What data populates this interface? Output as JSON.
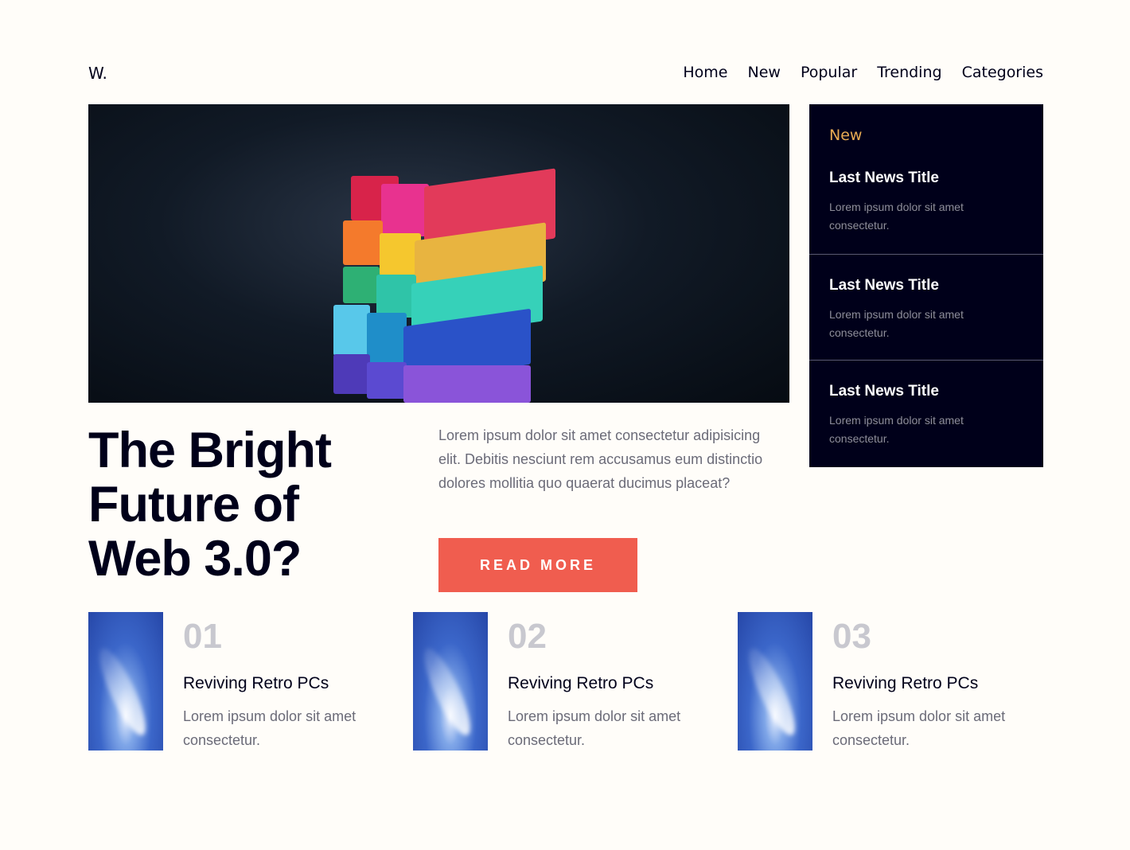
{
  "header": {
    "logo": "W.",
    "nav": [
      "Home",
      "New",
      "Popular",
      "Trending",
      "Categories"
    ]
  },
  "hero": {
    "image_alt": "colorful chalk pastels stacked",
    "title": "The Bright Future of Web 3.0?",
    "description": "Lorem ipsum dolor sit amet consectetur adipisicing elit. Debitis nesciunt rem accusamus eum distinctio dolores mollitia quo quaerat ducimus placeat?",
    "button": "READ MORE"
  },
  "sidebar": {
    "heading": "New",
    "items": [
      {
        "title": "Last News Title",
        "desc": "Lorem ipsum dolor sit amet consectetur."
      },
      {
        "title": "Last News Title",
        "desc": "Lorem ipsum dolor sit amet consectetur."
      },
      {
        "title": "Last News Title",
        "desc": "Lorem ipsum dolor sit amet consectetur."
      }
    ]
  },
  "cards": [
    {
      "num": "01",
      "title": "Reviving Retro PCs",
      "desc": "Lorem ipsum dolor sit amet consectetur."
    },
    {
      "num": "02",
      "title": "Reviving Retro PCs",
      "desc": "Lorem ipsum dolor sit amet consectetur."
    },
    {
      "num": "03",
      "title": "Reviving Retro PCs",
      "desc": "Lorem ipsum dolor sit amet consectetur."
    }
  ],
  "colors": {
    "background": "#fffdf9",
    "dark": "#00001a",
    "accent": "#f05d4f",
    "sidebar_heading": "#e9ab53",
    "muted": "#6b6b78"
  }
}
